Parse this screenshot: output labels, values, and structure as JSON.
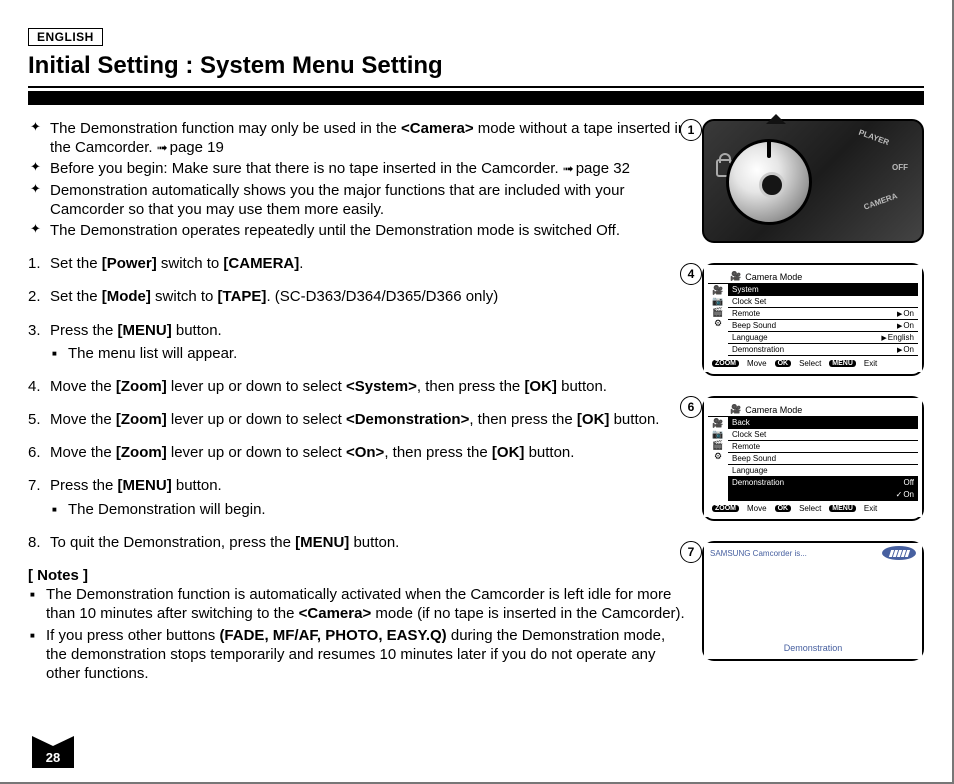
{
  "lang_badge": "ENGLISH",
  "title": "Initial Setting : System Menu Setting",
  "page_number": "28",
  "cross_items": [
    {
      "pre": "The Demonstration function may only be used in the ",
      "b1": "<Camera>",
      "post1": " mode without a tape inserted in the Camcorder. ",
      "ref": "page 19"
    },
    {
      "pre": "Before you begin: Make sure that there is no tape inserted in the Camcorder. ",
      "ref": "page 32"
    },
    {
      "pre": "Demonstration automatically shows you the major functions that are included with your Camcorder so that you may use them more easily."
    },
    {
      "pre": "The Demonstration operates repeatedly until the Demonstration mode is switched Off."
    }
  ],
  "steps": [
    {
      "pre": "Set the ",
      "b1": "[Power]",
      "mid": " switch to ",
      "b2": "[CAMERA]",
      "post": "."
    },
    {
      "pre": "Set the ",
      "b1": "[Mode]",
      "mid": " switch to ",
      "b2": "[TAPE]",
      "post": ". (SC-D363/D364/D365/D366 only)"
    },
    {
      "pre": "Press the ",
      "b1": "[MENU]",
      "post": " button.",
      "sub": "The menu list will appear."
    },
    {
      "pre": "Move the ",
      "b1": "[Zoom]",
      "mid": " lever up or down to select ",
      "b2": "<System>",
      "post2": ", then press the ",
      "b3": "[OK]",
      "post": " button."
    },
    {
      "pre": "Move the ",
      "b1": "[Zoom]",
      "mid": " lever up or down to select ",
      "b2": "<Demonstration>",
      "post2": ", then press the ",
      "b3": "[OK]",
      "post": " button."
    },
    {
      "pre": "Move the ",
      "b1": "[Zoom]",
      "mid": " lever up or down to select ",
      "b2": "<On>",
      "post2": ", then press the ",
      "b3": "[OK]",
      "post": " button."
    },
    {
      "pre": "Press the ",
      "b1": "[MENU]",
      "post": " button.",
      "sub": "The Demonstration will begin."
    },
    {
      "pre": "To quit the Demonstration, press the ",
      "b1": "[MENU]",
      "post": " button."
    }
  ],
  "notes_head": "[ Notes ]",
  "notes": [
    {
      "pre": "The Demonstration function is automatically activated when the Camcorder is left idle for more than 10 minutes after switching to the ",
      "b1": "<Camera>",
      "post": " mode (if no tape is inserted in the Camcorder)."
    },
    {
      "pre": "If you press other buttons ",
      "b1": "(FADE, MF/AF, PHOTO, EASY.Q)",
      "post": " during the Demonstration mode, the demonstration stops temporarily and resumes 10 minutes later if you do not operate any other functions."
    }
  ],
  "right": {
    "step_labels": {
      "p1": "1",
      "p4": "4",
      "p6": "6",
      "p7": "7"
    },
    "dial": {
      "top": "PLAYER",
      "mid": "OFF",
      "bot": "CAMERA"
    },
    "screen4": {
      "title": "Camera Mode",
      "icons": [
        "🎥",
        "📷",
        "🎬",
        "⚙"
      ],
      "rows": [
        {
          "label": "System",
          "hl": true,
          "noval": true
        },
        {
          "label": "Clock Set",
          "noval": true
        },
        {
          "label": "Remote",
          "val": "On"
        },
        {
          "label": "Beep Sound",
          "val": "On"
        },
        {
          "label": "Language",
          "val": "English"
        },
        {
          "label": "Demonstration",
          "val": "On"
        }
      ],
      "footer": {
        "zoom": "ZOOM",
        "move": "Move",
        "ok": "OK",
        "select": "Select",
        "menu": "MENU",
        "exit": "Exit"
      }
    },
    "screen6": {
      "title": "Camera Mode",
      "icons": [
        "🎥",
        "📷",
        "🎬",
        "⚙"
      ],
      "rows": [
        {
          "label": "Back",
          "hl": true,
          "noval": true
        },
        {
          "label": "Clock Set",
          "noval": true
        },
        {
          "label": "Remote",
          "noval": true
        },
        {
          "label": "Beep Sound",
          "noval": true
        },
        {
          "label": "Language",
          "noval": true
        },
        {
          "label": "Demonstration",
          "hl": true,
          "val": "Off",
          "noarrow": true
        },
        {
          "label": "",
          "val": "On",
          "ck": true,
          "hl": true,
          "noarrow": true
        }
      ],
      "footer": {
        "zoom": "ZOOM",
        "move": "Move",
        "ok": "OK",
        "select": "Select",
        "menu": "MENU",
        "exit": "Exit"
      }
    },
    "screen7": {
      "top": "SAMSUNG Camcorder is...",
      "caption": "Demonstration"
    }
  }
}
